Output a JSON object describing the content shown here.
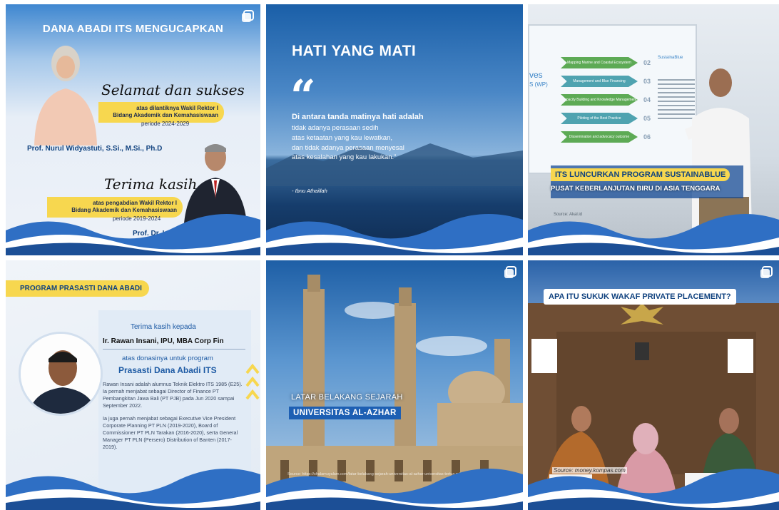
{
  "posts": [
    {
      "title": "DANA ABADI ITS MENGUCAPKAN",
      "greeting1": "Selamat dan sukses",
      "line1a": "atas dilantiknya Wakil Rektor I",
      "line1b": "Bidang Akademik dan Kemahasiswaan",
      "period1": "periode 2024-2029",
      "name1": "Prof. Nurul Widyastuti, S.Si., M.Si., Ph.D",
      "greeting2": "Terima kasih",
      "line2a": "atas pengabdian Wakil Rektor I",
      "line2b": "Bidang Akademik dan Kemahasiswaan",
      "period2": "periode 2019-2024",
      "name2": "Prof. Dr. Ir. Adi Soeprijanto, M.T."
    },
    {
      "title": "HATI YANG MATI",
      "quote_mark": "“",
      "quote_head": "Di antara tanda matinya hati adalah",
      "quote_body": [
        "tidak adanya perasaan sedih",
        "atas ketaatan yang kau lewatkan,",
        "dan tidak adanya perasaan menyesal",
        "atas kesalahan yang kau lakukan.”"
      ],
      "author": "- Ibnu Athaillah"
    },
    {
      "headline": "ITS LUNCURKAN PROGRAM SUSTAINABLUE",
      "subheadline": "PUSAT KEBERLANJUTAN BIRU DI ASIA TENGGARA",
      "source": "Source: Akal.id",
      "slide_word": "ves",
      "slide_word2": "S (WP)",
      "slide_logo": "SustainaBlue",
      "slide_steps": [
        {
          "label": "Mapping Marine and Coastal Ecosystem",
          "num": "02"
        },
        {
          "label": "Management and Blue Financing",
          "num": "03"
        },
        {
          "label": "Capacity Building and Knowledge Management",
          "num": "04"
        },
        {
          "label": "Piloting of the Best Practice",
          "num": "05"
        },
        {
          "label": "Dissemination and advocacy outcome",
          "num": "06"
        }
      ]
    },
    {
      "tag": "PROGRAM PRASASTI DANA ABADI",
      "thanks": "Terima kasih kepada",
      "donor": "Ir. Rawan Insani, IPU, MBA Corp Fin",
      "atas": "atas donasinya untuk program",
      "program": "Prasasti Dana Abadi ITS",
      "bio": [
        "Rawan Insani adalah alumnus Teknik Elektro ITS 1985 (E25). Ia pernah menjabat sebagai Director of Finance PT Pembangkitan Jawa Bali (PT PJB) pada Jun 2020 sampai September 2022.",
        "Ia juga pernah menjabat sebagai Executive Vice President Corporate Planning PT PLN (2019-2020), Board of Commissioner PT PLN Tarakan (2016-2020), serta General Manager PT PLN (Persero) Distribution of Banten (2017-2019)."
      ]
    },
    {
      "latar": "LATAR BELAKANG SEJARAH",
      "univ": "UNIVERSITAS AL-AZHAR",
      "source": "Source: https://shalamuyalam.com/latar-belakang-sejarah-universitas-al-azhar-universitas-tertua.pdf"
    },
    {
      "title": "APA ITU SUKUK WAKAF PRIVATE PLACEMENT?",
      "source": "Source: money.kompas.com"
    }
  ],
  "colors": {
    "brand_blue": "#10427f",
    "accent_yellow": "#f7d74f",
    "wave_blue": "#2f6fc4",
    "wave_light": "#ffffff"
  },
  "icons": {
    "corner": "instagram-multi-post-icon"
  }
}
